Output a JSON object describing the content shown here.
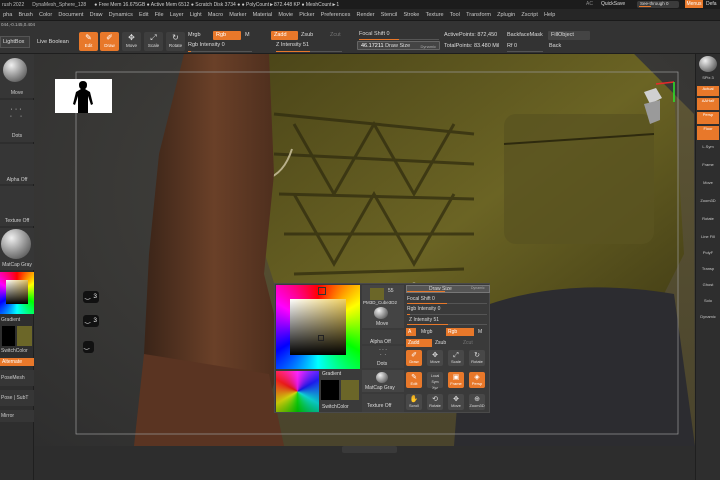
{
  "titlebar": {
    "app_title": "rush 2022",
    "doc": "DynaMesh_Sphere_128",
    "stats": "● Free Mem 16.675GB ● Active Mem 6512 ● Scratch Disk 3734 ● ● PolyCount►872.448 KP ● MeshCount►1",
    "ae": "AC",
    "quicksave": "QuickSave",
    "see_through": "See-through 0",
    "menus": "Menus",
    "default": "Defa"
  },
  "menubar": [
    "pha",
    "Brush",
    "Color",
    "Document",
    "Draw",
    "Dynamics",
    "Edit",
    "File",
    "Layer",
    "Light",
    "Macro",
    "Marker",
    "Material",
    "Movie",
    "Picker",
    "Preferences",
    "Render",
    "Stencil",
    "Stroke",
    "Texture",
    "Tool",
    "Transform",
    "Zplugin",
    "Zscript",
    "Help"
  ],
  "topshelf": {
    "lightbox": "LightBox",
    "live_boolean": "Live Boolean",
    "edit": "Edit",
    "draw": "Draw",
    "move": "Move",
    "scale": "Scale",
    "rotate": "Rotate",
    "mrgb": "Mrgb",
    "rgb": "Rgb",
    "m": "M",
    "rgb_intensity": "Rgb Intensity 0",
    "zadd": "Zadd",
    "zsub": "Zsub",
    "zcut": "Zcut",
    "z_intensity": "Z Intensity 51",
    "focal_shift": "Focal Shift 0",
    "draw_size_value": "46.17211",
    "draw_size_label": "Draw Size",
    "dynamic": "Dynamic",
    "active_points": "ActivePoints: 872,450",
    "total_points": "TotalPoints: 83.480 Mil",
    "backface_mask": "BackfaceMask",
    "rf": "Rf 0",
    "fill_object": "FillObject",
    "back": "Back"
  },
  "lefttray": {
    "move": "Move",
    "dots": "Dots",
    "alpha_off": "Alpha Off",
    "texture_off": "Texture Off",
    "matcap_gray": "MatCap Gray",
    "gradient": "Gradient",
    "switchcolor": "SwitchColor",
    "alternate": "Alternate",
    "posemesh": "PoseMesh",
    "pose_subt": "Pose | SubT",
    "mirror": "Mirror",
    "coords": "044,-0.145,0.404"
  },
  "hotkeys": [
    "3",
    "3",
    ""
  ],
  "popup": {
    "brush_count": "55",
    "brush_name": "PM3D_Cube3D2",
    "move": "Move",
    "alpha_off": "Alpha Off",
    "dots": "Dots",
    "matcap_gray": "MatCap Gray",
    "texture_off": "Texture Off",
    "gradient": "Gradient",
    "switchcolor": "SwitchColor",
    "draw_size": "Draw Size",
    "dynamic": "Dynamic",
    "focal_shift": "Focal Shift 0",
    "rgb_intensity": "Rgb Intensity 0",
    "z_intensity": "Z Intensity 51",
    "a": "A",
    "mrgb": "Mrgb",
    "rgb": "Rgb",
    "m": "M",
    "zadd": "Zadd",
    "zsub": "Zsub",
    "zcut": "Zcut",
    "draw": "Draw",
    "move_btn": "Move",
    "scale": "Scale",
    "rotate": "Rotate",
    "edit": "Edit",
    "local_sym": "Local Sym",
    "xyz": "Xyz",
    "frame": "Frame",
    "persp": "Persp",
    "scroll": "Scroll",
    "rotate2": "Rotate",
    "move2": "Move",
    "zoom3d": "Zoom3D"
  },
  "righttray": {
    "spix": "SPix 3",
    "actual": "Actual",
    "aahalf": "AAHalf",
    "persp": "Persp",
    "floor": "Floor",
    "l_sym": "L.Sym",
    "frame": "Frame",
    "move": "Move",
    "zoom3d": "Zoom3D",
    "rotate": "Rotate",
    "line_fill": "Line Fill",
    "polyf": "PolyF",
    "transp": "Transp",
    "ghost": "Ghost",
    "solo": "Solo",
    "dynamic": "Dynamic"
  },
  "colors": {
    "accent": "#e8782a",
    "panel": "#333333",
    "canvas": "#3c3b38",
    "swatch_primary": "#000000",
    "swatch_secondary": "#6b6628"
  },
  "sliders": {
    "see_through": 0.0,
    "rgb_intensity": 0.0,
    "z_intensity": 0.51,
    "focal_shift": 0.5,
    "draw_size": 0.46
  }
}
